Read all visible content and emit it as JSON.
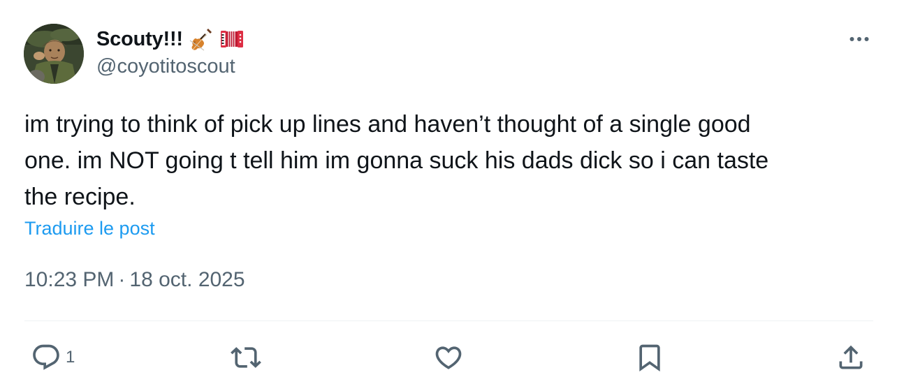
{
  "author": {
    "display_name": "Scouty!!!",
    "emojis": [
      "violin",
      "accordion"
    ],
    "handle": "@coyotitoscout"
  },
  "tweet": {
    "text": "im trying to think of pick up lines and haven’t thought of a single good\none. im NOT going t tell him im gonna suck his dads dick so i can taste\nthe recipe.",
    "translate_label": "Traduire le post",
    "time": "10:23 PM",
    "separator": "·",
    "date": "18 oct. 2025"
  },
  "actions": {
    "reply_count": "1",
    "icons": [
      "reply-icon",
      "retweet-icon",
      "like-icon",
      "bookmark-icon",
      "share-icon"
    ]
  },
  "colors": {
    "text": "#0f1419",
    "secondary": "#536471",
    "link": "#1d9bf0",
    "divider": "#eff3f4"
  }
}
